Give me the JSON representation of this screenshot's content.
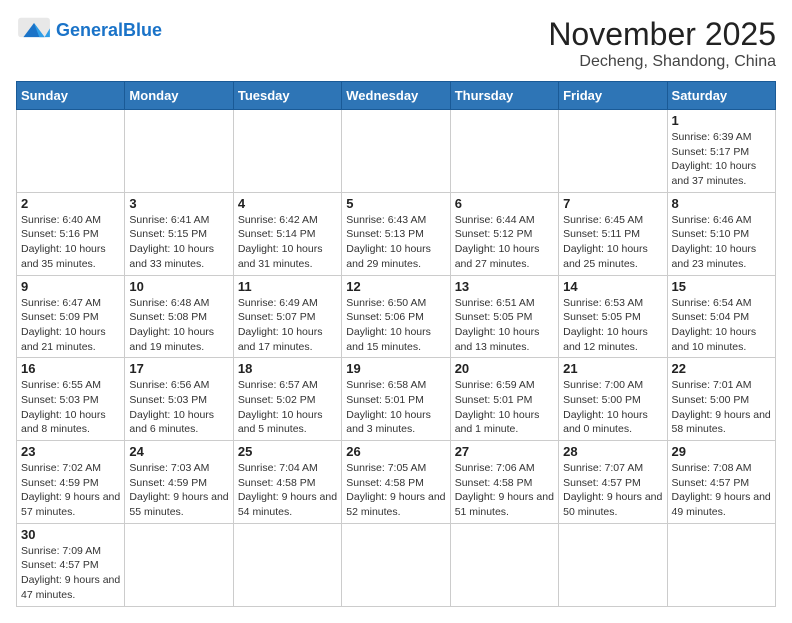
{
  "header": {
    "logo_general": "General",
    "logo_blue": "Blue",
    "month_title": "November 2025",
    "location": "Decheng, Shandong, China"
  },
  "weekdays": [
    "Sunday",
    "Monday",
    "Tuesday",
    "Wednesday",
    "Thursday",
    "Friday",
    "Saturday"
  ],
  "days": [
    {
      "date": "",
      "info": ""
    },
    {
      "date": "",
      "info": ""
    },
    {
      "date": "",
      "info": ""
    },
    {
      "date": "",
      "info": ""
    },
    {
      "date": "",
      "info": ""
    },
    {
      "date": "",
      "info": ""
    },
    {
      "date": "1",
      "info": "Sunrise: 6:39 AM\nSunset: 5:17 PM\nDaylight: 10 hours and 37 minutes."
    },
    {
      "date": "2",
      "info": "Sunrise: 6:40 AM\nSunset: 5:16 PM\nDaylight: 10 hours and 35 minutes."
    },
    {
      "date": "3",
      "info": "Sunrise: 6:41 AM\nSunset: 5:15 PM\nDaylight: 10 hours and 33 minutes."
    },
    {
      "date": "4",
      "info": "Sunrise: 6:42 AM\nSunset: 5:14 PM\nDaylight: 10 hours and 31 minutes."
    },
    {
      "date": "5",
      "info": "Sunrise: 6:43 AM\nSunset: 5:13 PM\nDaylight: 10 hours and 29 minutes."
    },
    {
      "date": "6",
      "info": "Sunrise: 6:44 AM\nSunset: 5:12 PM\nDaylight: 10 hours and 27 minutes."
    },
    {
      "date": "7",
      "info": "Sunrise: 6:45 AM\nSunset: 5:11 PM\nDaylight: 10 hours and 25 minutes."
    },
    {
      "date": "8",
      "info": "Sunrise: 6:46 AM\nSunset: 5:10 PM\nDaylight: 10 hours and 23 minutes."
    },
    {
      "date": "9",
      "info": "Sunrise: 6:47 AM\nSunset: 5:09 PM\nDaylight: 10 hours and 21 minutes."
    },
    {
      "date": "10",
      "info": "Sunrise: 6:48 AM\nSunset: 5:08 PM\nDaylight: 10 hours and 19 minutes."
    },
    {
      "date": "11",
      "info": "Sunrise: 6:49 AM\nSunset: 5:07 PM\nDaylight: 10 hours and 17 minutes."
    },
    {
      "date": "12",
      "info": "Sunrise: 6:50 AM\nSunset: 5:06 PM\nDaylight: 10 hours and 15 minutes."
    },
    {
      "date": "13",
      "info": "Sunrise: 6:51 AM\nSunset: 5:05 PM\nDaylight: 10 hours and 13 minutes."
    },
    {
      "date": "14",
      "info": "Sunrise: 6:53 AM\nSunset: 5:05 PM\nDaylight: 10 hours and 12 minutes."
    },
    {
      "date": "15",
      "info": "Sunrise: 6:54 AM\nSunset: 5:04 PM\nDaylight: 10 hours and 10 minutes."
    },
    {
      "date": "16",
      "info": "Sunrise: 6:55 AM\nSunset: 5:03 PM\nDaylight: 10 hours and 8 minutes."
    },
    {
      "date": "17",
      "info": "Sunrise: 6:56 AM\nSunset: 5:03 PM\nDaylight: 10 hours and 6 minutes."
    },
    {
      "date": "18",
      "info": "Sunrise: 6:57 AM\nSunset: 5:02 PM\nDaylight: 10 hours and 5 minutes."
    },
    {
      "date": "19",
      "info": "Sunrise: 6:58 AM\nSunset: 5:01 PM\nDaylight: 10 hours and 3 minutes."
    },
    {
      "date": "20",
      "info": "Sunrise: 6:59 AM\nSunset: 5:01 PM\nDaylight: 10 hours and 1 minute."
    },
    {
      "date": "21",
      "info": "Sunrise: 7:00 AM\nSunset: 5:00 PM\nDaylight: 10 hours and 0 minutes."
    },
    {
      "date": "22",
      "info": "Sunrise: 7:01 AM\nSunset: 5:00 PM\nDaylight: 9 hours and 58 minutes."
    },
    {
      "date": "23",
      "info": "Sunrise: 7:02 AM\nSunset: 4:59 PM\nDaylight: 9 hours and 57 minutes."
    },
    {
      "date": "24",
      "info": "Sunrise: 7:03 AM\nSunset: 4:59 PM\nDaylight: 9 hours and 55 minutes."
    },
    {
      "date": "25",
      "info": "Sunrise: 7:04 AM\nSunset: 4:58 PM\nDaylight: 9 hours and 54 minutes."
    },
    {
      "date": "26",
      "info": "Sunrise: 7:05 AM\nSunset: 4:58 PM\nDaylight: 9 hours and 52 minutes."
    },
    {
      "date": "27",
      "info": "Sunrise: 7:06 AM\nSunset: 4:58 PM\nDaylight: 9 hours and 51 minutes."
    },
    {
      "date": "28",
      "info": "Sunrise: 7:07 AM\nSunset: 4:57 PM\nDaylight: 9 hours and 50 minutes."
    },
    {
      "date": "29",
      "info": "Sunrise: 7:08 AM\nSunset: 4:57 PM\nDaylight: 9 hours and 49 minutes."
    },
    {
      "date": "30",
      "info": "Sunrise: 7:09 AM\nSunset: 4:57 PM\nDaylight: 9 hours and 47 minutes."
    },
    {
      "date": "",
      "info": ""
    },
    {
      "date": "",
      "info": ""
    },
    {
      "date": "",
      "info": ""
    },
    {
      "date": "",
      "info": ""
    },
    {
      "date": "",
      "info": ""
    },
    {
      "date": "",
      "info": ""
    }
  ]
}
